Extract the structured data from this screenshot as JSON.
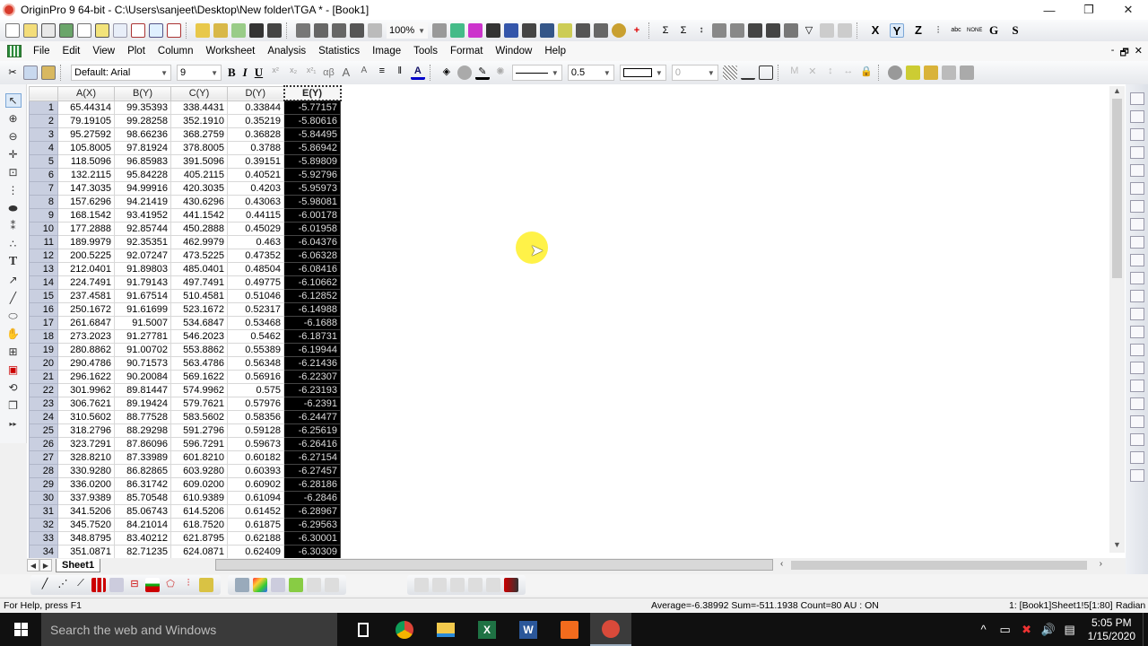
{
  "window": {
    "title": "OriginPro 9 64-bit - C:\\Users\\sanjeet\\Desktop\\New folder\\TGA * - [Book1]",
    "controls": {
      "minimize": "—",
      "restore": "❐",
      "close": "✕"
    }
  },
  "toolbar_standard": {
    "zoom_value": "100%",
    "column_buttons": [
      "X",
      "Y",
      "Z",
      "G",
      "S"
    ],
    "active_column_button": "Y"
  },
  "menu": {
    "items": [
      "File",
      "Edit",
      "View",
      "Plot",
      "Column",
      "Worksheet",
      "Analysis",
      "Statistics",
      "Image",
      "Tools",
      "Format",
      "Window",
      "Help"
    ],
    "mdi_controls": [
      "-",
      "🗗",
      "✕"
    ]
  },
  "format_toolbar": {
    "font_name": "Default: Arial",
    "font_size": "9",
    "bold": "B",
    "italic": "I",
    "underline": "U",
    "greek": "αβ",
    "line_width": "0.5",
    "angle": "0"
  },
  "worksheet": {
    "columns": [
      "A(X)",
      "B(Y)",
      "C(Y)",
      "D(Y)",
      "E(Y)"
    ],
    "selected_column": "E(Y)",
    "rows": [
      [
        "1",
        "65.44314",
        "99.35393",
        "338.4431",
        "0.33844",
        "-5.77157"
      ],
      [
        "2",
        "79.19105",
        "99.28258",
        "352.1910",
        "0.35219",
        "-5.80616"
      ],
      [
        "3",
        "95.27592",
        "98.66236",
        "368.2759",
        "0.36828",
        "-5.84495"
      ],
      [
        "4",
        "105.8005",
        "97.81924",
        "378.8005",
        "0.3788",
        "-5.86942"
      ],
      [
        "5",
        "118.5096",
        "96.85983",
        "391.5096",
        "0.39151",
        "-5.89809"
      ],
      [
        "6",
        "132.2115",
        "95.84228",
        "405.2115",
        "0.40521",
        "-5.92796"
      ],
      [
        "7",
        "147.3035",
        "94.99916",
        "420.3035",
        "0.4203",
        "-5.95973"
      ],
      [
        "8",
        "157.6296",
        "94.21419",
        "430.6296",
        "0.43063",
        "-5.98081"
      ],
      [
        "9",
        "168.1542",
        "93.41952",
        "441.1542",
        "0.44115",
        "-6.00178"
      ],
      [
        "10",
        "177.2888",
        "92.85744",
        "450.2888",
        "0.45029",
        "-6.01958"
      ],
      [
        "11",
        "189.9979",
        "92.35351",
        "462.9979",
        "0.463",
        "-6.04376"
      ],
      [
        "12",
        "200.5225",
        "92.07247",
        "473.5225",
        "0.47352",
        "-6.06328"
      ],
      [
        "13",
        "212.0401",
        "91.89803",
        "485.0401",
        "0.48504",
        "-6.08416"
      ],
      [
        "14",
        "224.7491",
        "91.79143",
        "497.7491",
        "0.49775",
        "-6.10662"
      ],
      [
        "15",
        "237.4581",
        "91.67514",
        "510.4581",
        "0.51046",
        "-6.12852"
      ],
      [
        "16",
        "250.1672",
        "91.61699",
        "523.1672",
        "0.52317",
        "-6.14988"
      ],
      [
        "17",
        "261.6847",
        "91.5007",
        "534.6847",
        "0.53468",
        "-6.1688"
      ],
      [
        "18",
        "273.2023",
        "91.27781",
        "546.2023",
        "0.5462",
        "-6.18731"
      ],
      [
        "19",
        "280.8862",
        "91.00702",
        "553.8862",
        "0.55389",
        "-6.19944"
      ],
      [
        "20",
        "290.4786",
        "90.71573",
        "563.4786",
        "0.56348",
        "-6.21436"
      ],
      [
        "21",
        "296.1622",
        "90.20084",
        "569.1622",
        "0.56916",
        "-6.22307"
      ],
      [
        "22",
        "301.9962",
        "89.81447",
        "574.9962",
        "0.575",
        "-6.23193"
      ],
      [
        "23",
        "306.7621",
        "89.19424",
        "579.7621",
        "0.57976",
        "-6.2391"
      ],
      [
        "24",
        "310.5602",
        "88.77528",
        "583.5602",
        "0.58356",
        "-6.24477"
      ],
      [
        "25",
        "318.2796",
        "88.29298",
        "591.2796",
        "0.59128",
        "-6.25619"
      ],
      [
        "26",
        "323.7291",
        "87.86096",
        "596.7291",
        "0.59673",
        "-6.26416"
      ],
      [
        "27",
        "328.8210",
        "87.33989",
        "601.8210",
        "0.60182",
        "-6.27154"
      ],
      [
        "28",
        "330.9280",
        "86.82865",
        "603.9280",
        "0.60393",
        "-6.27457"
      ],
      [
        "29",
        "336.0200",
        "86.31742",
        "609.0200",
        "0.60902",
        "-6.28186"
      ],
      [
        "30",
        "337.9389",
        "85.70548",
        "610.9389",
        "0.61094",
        "-6.2846"
      ],
      [
        "31",
        "341.5206",
        "85.06743",
        "614.5206",
        "0.61452",
        "-6.28967"
      ],
      [
        "32",
        "345.7520",
        "84.21014",
        "618.7520",
        "0.61875",
        "-6.29563"
      ],
      [
        "33",
        "348.8795",
        "83.40212",
        "621.8795",
        "0.62188",
        "-6.30001"
      ],
      [
        "34",
        "351.0871",
        "82.71235",
        "624.0871",
        "0.62409",
        "-6.30309"
      ]
    ],
    "sheet_tab": "Sheet1"
  },
  "status": {
    "help": "For Help, press F1",
    "stats": "Average=-6.38992 Sum=-511.1938 Count=80  AU : ON",
    "selection": "1: [Book1]Sheet1!5[1:80]",
    "angle_unit": "Radian"
  },
  "taskbar": {
    "search_placeholder": "Search the web and Windows",
    "apps": [
      "task-view",
      "chrome",
      "file-explorer",
      "excel",
      "word",
      "screen-recorder",
      "originpro"
    ],
    "time": "5:05 PM",
    "date": "1/15/2020"
  }
}
